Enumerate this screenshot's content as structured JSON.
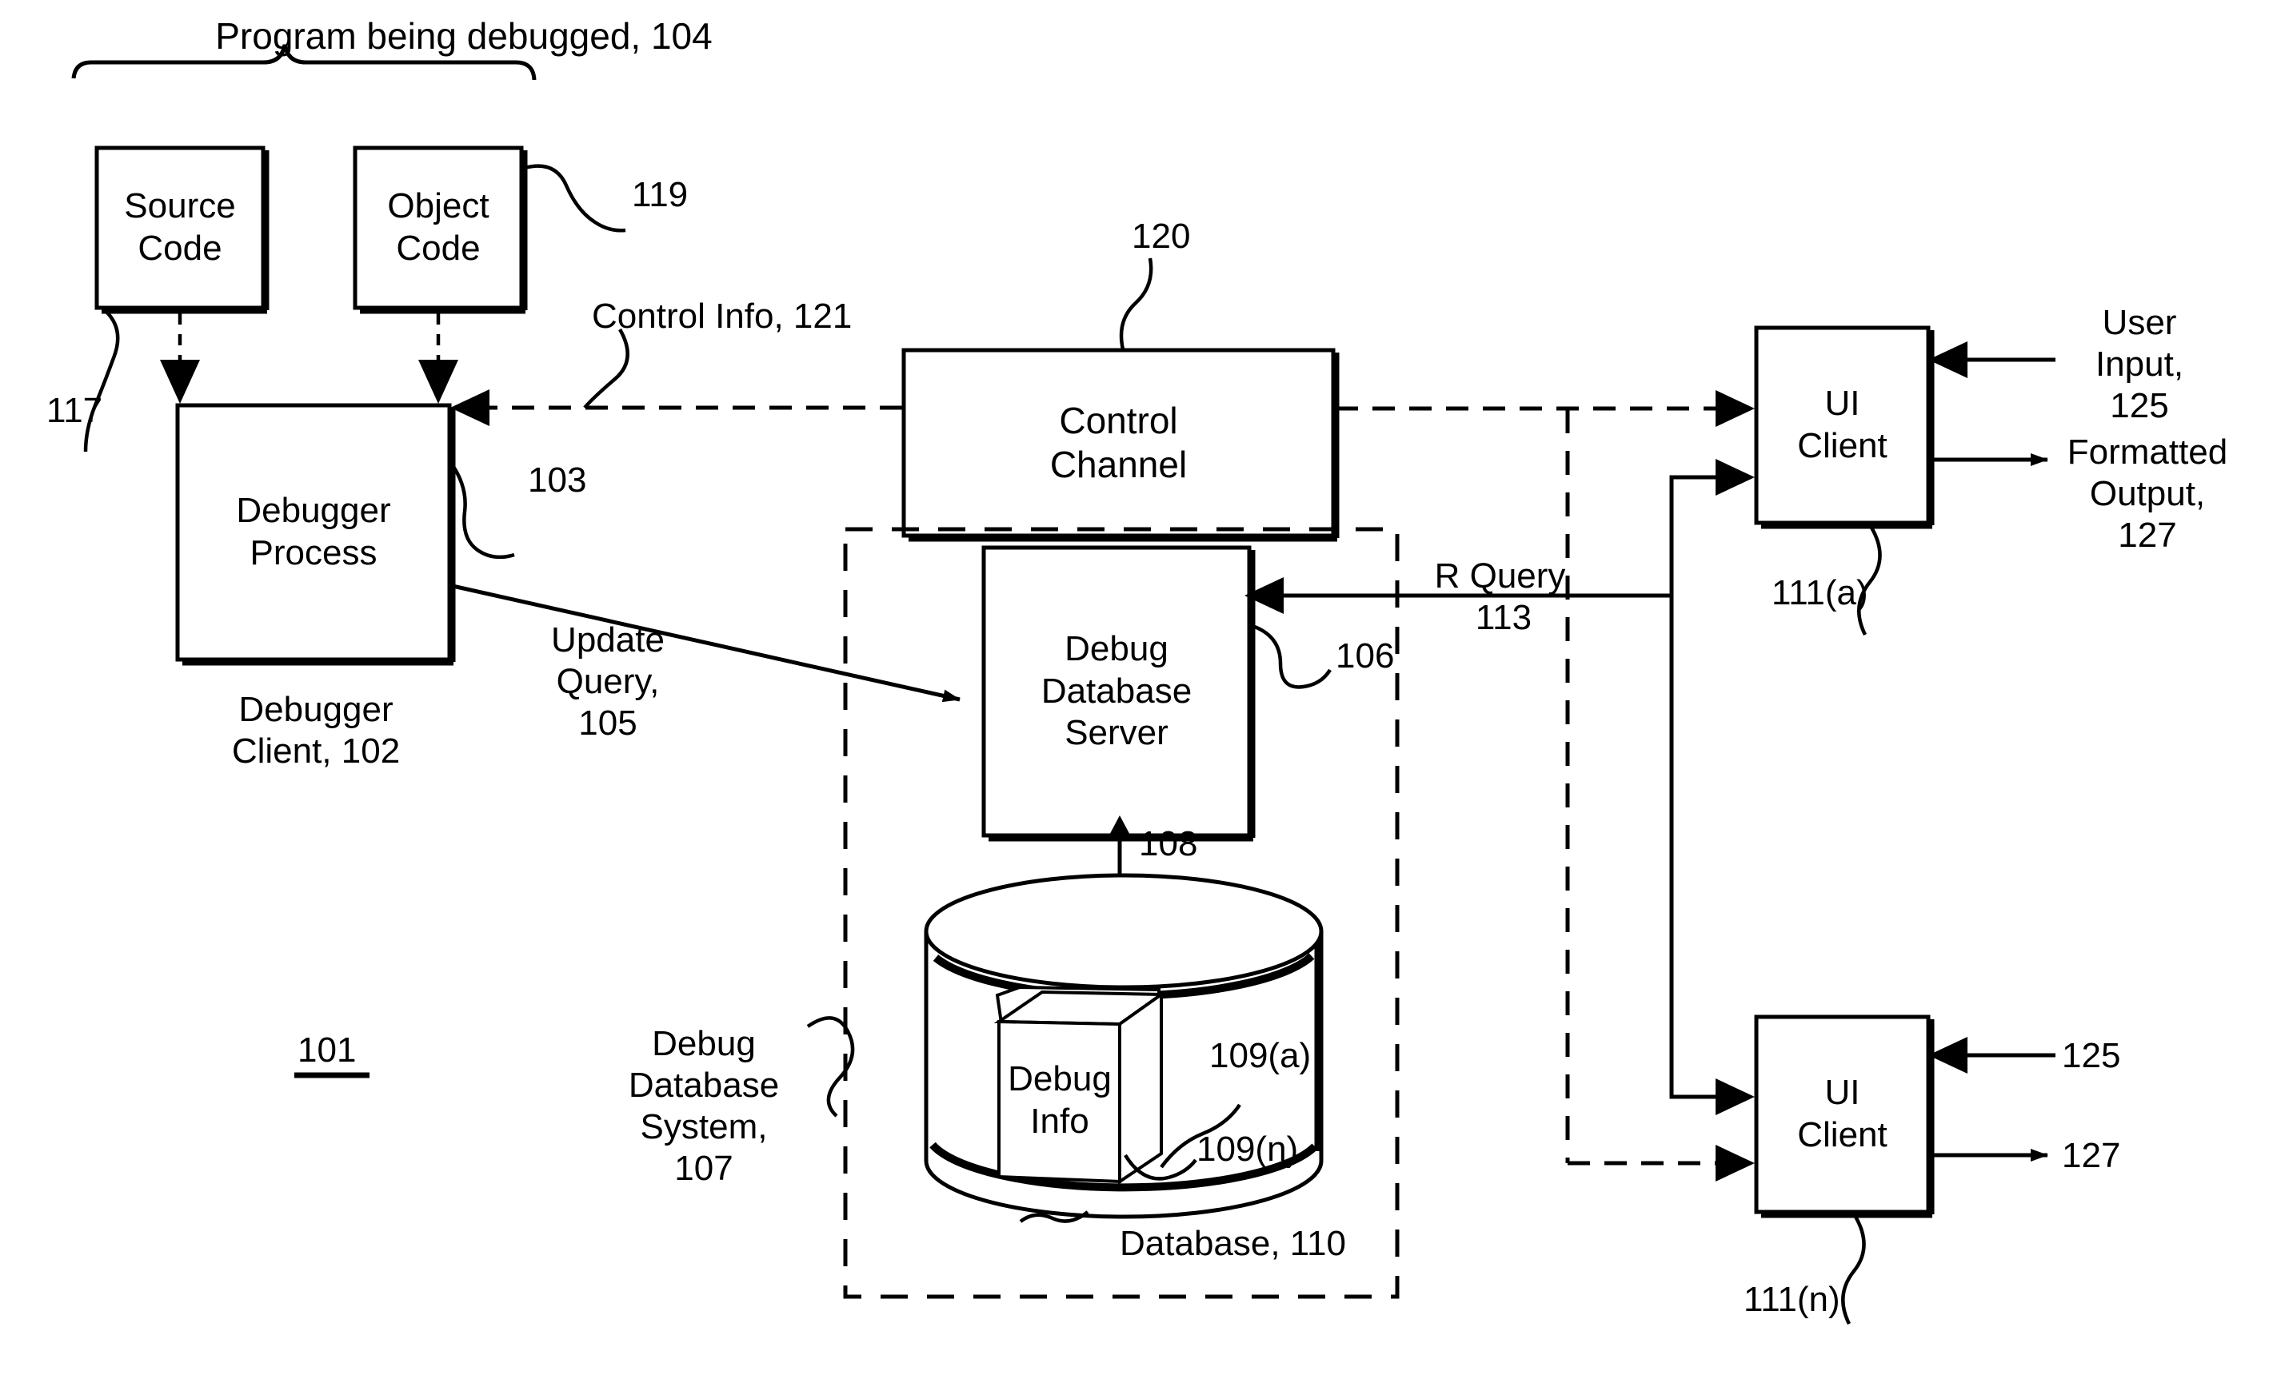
{
  "figure": {
    "system_ref": "101",
    "brace_label": "Program being debugged, 104"
  },
  "boxes": {
    "source_code": {
      "label": "Source\nCode",
      "ref": "117"
    },
    "object_code": {
      "label": "Object\nCode",
      "ref": "119"
    },
    "debugger_process": {
      "label": "Debugger\nProcess",
      "ref": "103",
      "caption": "Debugger\nClient, 102"
    },
    "control_channel": {
      "label": "Control\nChannel",
      "ref": "120"
    },
    "debug_database_server": {
      "label": "Debug\nDatabase\nServer",
      "ref": "106"
    },
    "ui_client_a": {
      "label": "UI\nClient",
      "ref": "111(a)"
    },
    "ui_client_n": {
      "label": "UI\nClient",
      "ref": "111(n)"
    },
    "debug_info": {
      "label": "Debug\nInfo",
      "ref_front": "109(a)",
      "ref_back": "109(n)"
    }
  },
  "regions": {
    "debug_database_system": {
      "label": "Debug\nDatabase\nSystem,\n107"
    },
    "database": {
      "label": "Database, 110"
    }
  },
  "flows": {
    "control_info": "Control Info, 121",
    "update_query": "Update\nQuery,\n105",
    "r_query": "R Query,\n113",
    "server_db_link": "108",
    "user_input_a": "User\nInput,\n125",
    "formatted_output_a": "Formatted\nOutput,\n127",
    "user_input_n": "125",
    "formatted_output_n": "127"
  },
  "style": {
    "ink": "#000000",
    "paper": "#ffffff"
  }
}
